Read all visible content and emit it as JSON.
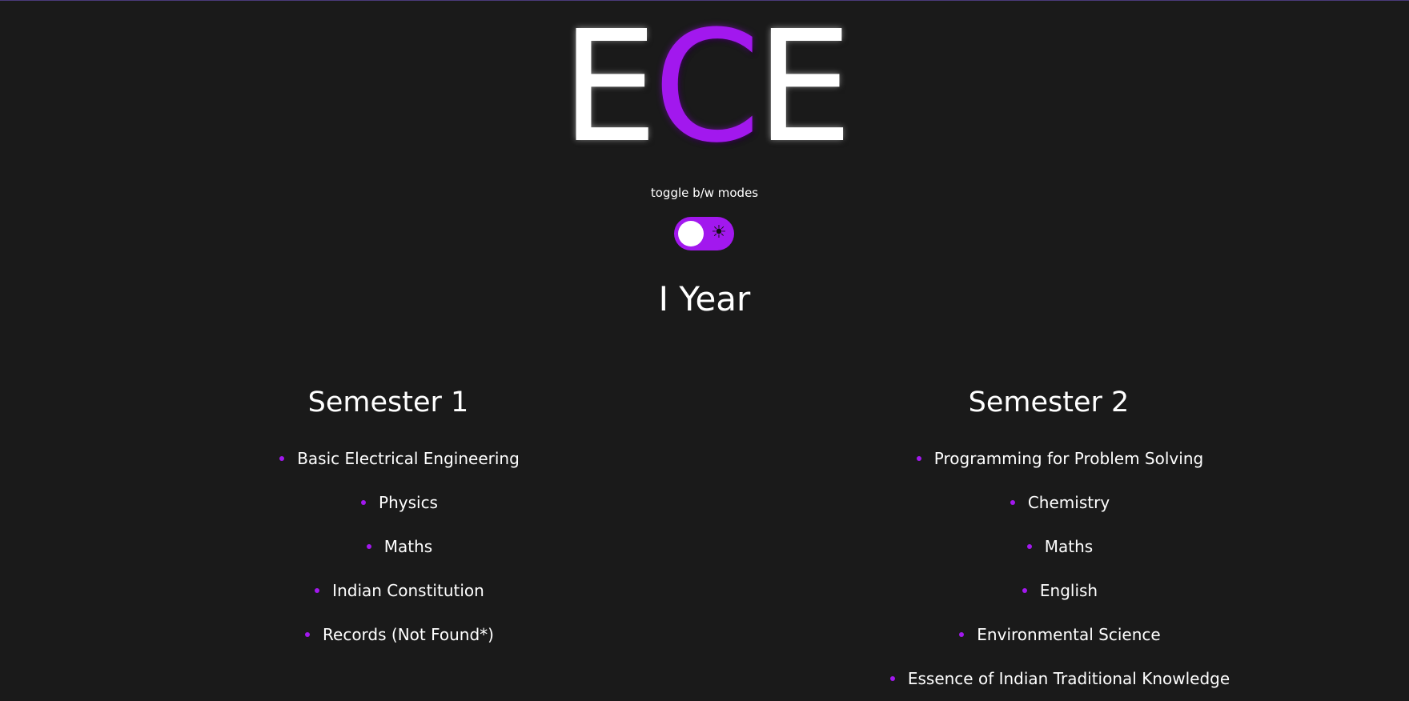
{
  "header": {
    "logo_letters": [
      "E",
      "C",
      "E"
    ],
    "accent_color": "#a218ee"
  },
  "theme_toggle": {
    "label": "toggle b/w modes",
    "icon": "sun-icon",
    "icon_glyph": "☀"
  },
  "year": {
    "title": "I Year"
  },
  "semesters": [
    {
      "title": "Semester 1",
      "subjects": [
        "Basic Electrical Engineering",
        "Physics",
        "Maths",
        "Indian Constitution",
        "Records (Not Found*)"
      ]
    },
    {
      "title": "Semester 2",
      "subjects": [
        "Programming for Problem Solving",
        "Chemistry",
        "Maths",
        "English",
        "Environmental Science",
        "Essence of Indian Traditional Knowledge"
      ]
    }
  ]
}
